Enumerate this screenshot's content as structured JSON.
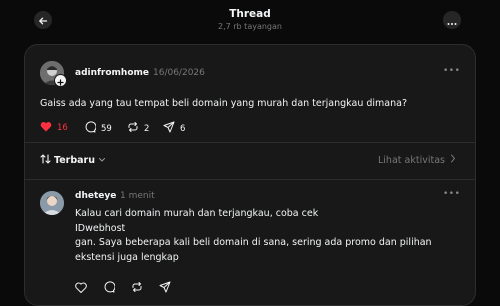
{
  "header": {
    "title": "Thread",
    "views": "2,7 rb tayangan"
  },
  "post": {
    "username": "adinfromhome",
    "date": "16/06/2026",
    "text": "Gaiss ada yang tau tempat beli domain yang murah dan terjangkau dimana?",
    "likes": "16",
    "replies": "59",
    "reposts": "2",
    "shares": "6"
  },
  "replies_bar": {
    "sort_label": "Terbaru",
    "activity_label": "Lihat aktivitas"
  },
  "reply": {
    "username": "dheteye",
    "time": "1 menit",
    "lines": [
      "Kalau cari domain murah dan terjangkau, coba cek",
      "IDwebhost",
      "gan. Saya beberapa kali beli domain di sana, sering ada promo dan pilihan",
      "ekstensi juga lengkap"
    ]
  },
  "colors": {
    "background": "#0a0a0a",
    "panel": "#181818",
    "like": "#ff3040",
    "muted": "#777777"
  }
}
